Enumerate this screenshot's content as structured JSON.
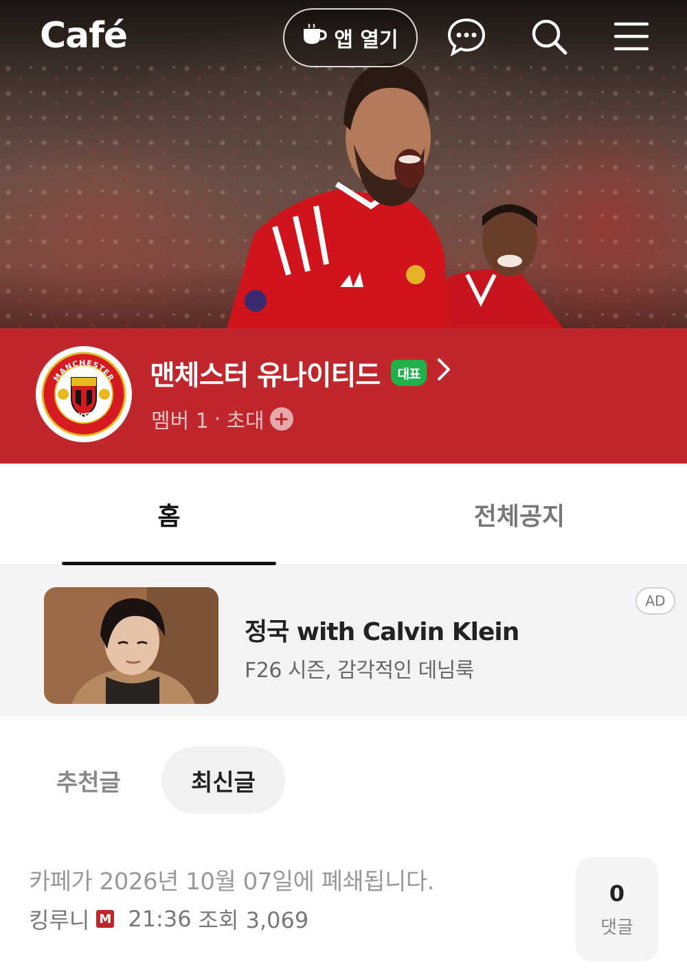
{
  "header": {
    "logo": "Café",
    "open_app_label": "앱 열기",
    "icons": [
      "coffee-cup-icon",
      "chat-bubble-icon",
      "search-icon",
      "menu-icon"
    ]
  },
  "cafe": {
    "name": "맨체스터 유나이티드",
    "rep_badge": "대표",
    "members_label": "멤버 1",
    "separator": "·",
    "invite_label": "초대",
    "invite_icon": "+",
    "crest_top_text": "MANCHESTER",
    "crest_bottom_text": "UNITED",
    "theme_color": "#c0272d"
  },
  "tabs": [
    {
      "label": "홈",
      "active": true
    },
    {
      "label": "전체공지",
      "active": false
    }
  ],
  "ad": {
    "title": "정국 with Calvin Klein",
    "subtitle": "F26 시즌, 감각적인 데님룩",
    "label": "AD"
  },
  "filters": [
    {
      "label": "추천글",
      "active": false
    },
    {
      "label": "최신글",
      "active": true
    }
  ],
  "posts": [
    {
      "title": "카페가 2026년 10월 07일에 폐쇄됩니다.",
      "author": "킹루니",
      "author_badge": "M",
      "time": "21:36",
      "views": "조회 3,069",
      "comment_count": "0",
      "comment_label": "댓글"
    }
  ]
}
